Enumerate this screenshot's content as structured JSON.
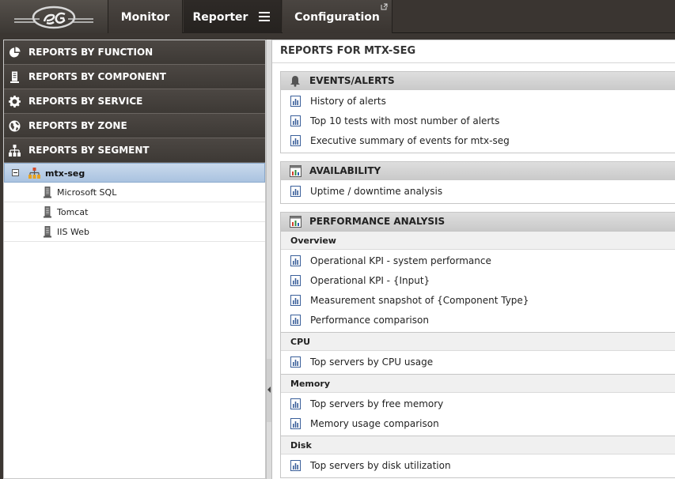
{
  "nav": {
    "tabs": [
      {
        "label": "Monitor"
      },
      {
        "label": "Reporter"
      },
      {
        "label": "Configuration"
      }
    ]
  },
  "sidebar": {
    "categories": [
      {
        "label": "REPORTS BY FUNCTION",
        "icon": "pie-chart-icon"
      },
      {
        "label": "REPORTS BY COMPONENT",
        "icon": "server-icon"
      },
      {
        "label": "REPORTS BY SERVICE",
        "icon": "gear-icon"
      },
      {
        "label": "REPORTS BY ZONE",
        "icon": "globe-icon"
      },
      {
        "label": "REPORTS BY SEGMENT",
        "icon": "hierarchy-icon"
      }
    ],
    "tree": {
      "root_label": "mtx-seg",
      "children": [
        {
          "label": "Microsoft SQL"
        },
        {
          "label": "Tomcat"
        },
        {
          "label": "IIS Web"
        }
      ]
    }
  },
  "main": {
    "title": "REPORTS FOR MTX-SEG",
    "sections": [
      {
        "title": "EVENTS/ALERTS",
        "icon": "bell-icon",
        "reports": [
          "History of alerts",
          "Top 10 tests with most number of alerts",
          "Executive summary of events for mtx-seg"
        ]
      },
      {
        "title": "AVAILABILITY",
        "icon": "chart-window-icon",
        "reports": [
          "Uptime / downtime analysis"
        ]
      },
      {
        "title": "PERFORMANCE ANALYSIS",
        "icon": "chart-window-icon",
        "groups": [
          {
            "label": "Overview",
            "reports": [
              "Operational KPI - system performance",
              "Operational KPI - {Input}",
              "Measurement snapshot of {Component Type}",
              "Performance comparison"
            ]
          },
          {
            "label": "CPU",
            "reports": [
              "Top servers by CPU usage"
            ]
          },
          {
            "label": "Memory",
            "reports": [
              "Top servers by free memory",
              "Memory usage comparison"
            ]
          },
          {
            "label": "Disk",
            "reports": [
              "Top servers by disk utilization"
            ]
          }
        ]
      }
    ]
  }
}
